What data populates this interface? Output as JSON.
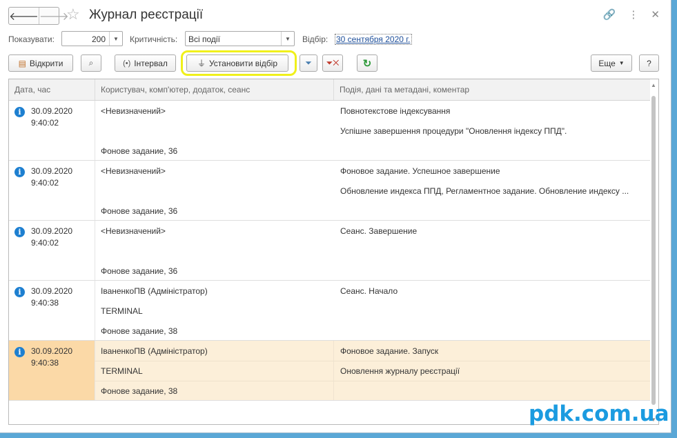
{
  "window": {
    "title": "Журнал реєстрації",
    "nav_back": "🡐",
    "nav_forward": "🡒",
    "star": "☆",
    "link_icon": "🔗",
    "more_icon": "⋮",
    "close_icon": "✕"
  },
  "filters": {
    "show_label": "Показувати:",
    "show_value": "200",
    "criticality_label": "Критичність:",
    "criticality_value": "Всі події",
    "selection_label": "Відбір:",
    "selection_value": "30 сентября 2020 г."
  },
  "toolbar": {
    "open_label": "Відкрити",
    "interval_label": "Інтервал",
    "set_filter_label": "Установити відбір",
    "more_label": "Еще",
    "help_label": "?"
  },
  "table": {
    "columns": [
      "Дата, час",
      "Користувач, комп'ютер, додаток, сеанс",
      "Подія, дані та метадані, коментар"
    ],
    "rows": [
      {
        "date": "30.09.2020",
        "time": "9:40:02",
        "user": "<Невизначений>",
        "computer": "",
        "app": "Фонове задание, 36",
        "event": "Повнотекстове індексування",
        "data": "Успішне завершення процедури \"Оновлення індексу ППД\".",
        "comment": ""
      },
      {
        "date": "30.09.2020",
        "time": "9:40:02",
        "user": "<Невизначений>",
        "computer": "",
        "app": "Фонове задание, 36",
        "event": "Фоновое задание. Успешное завершение",
        "data": "Обновление индекса ППД, Регламентное задание. Обновление индексу ...",
        "comment": ""
      },
      {
        "date": "30.09.2020",
        "time": "9:40:02",
        "user": "<Невизначений>",
        "computer": "",
        "app": "Фонове задание, 36",
        "event": "Сеанс. Завершение",
        "data": "",
        "comment": ""
      },
      {
        "date": "30.09.2020",
        "time": "9:40:38",
        "user": "ІваненкоПВ (Адміністратор)",
        "computer": "TERMINAL",
        "app": "Фонове задание, 38",
        "event": "Сеанс. Начало",
        "data": "",
        "comment": ""
      },
      {
        "date": "30.09.2020",
        "time": "9:40:38",
        "user": "ІваненкоПВ (Адміністратор)",
        "computer": "TERMINAL",
        "app": "Фонове задание, 38",
        "event": "Фоновое задание. Запуск",
        "data": "Оновлення журналу реєстрації",
        "comment": ""
      }
    ],
    "selected_row": 4
  },
  "watermark": "pdk.com.ua",
  "colors": {
    "accent": "#1d7fd0",
    "selected_row": "#fcefd9",
    "highlight": "#f0f01a",
    "watermark": "#1b9be0"
  }
}
